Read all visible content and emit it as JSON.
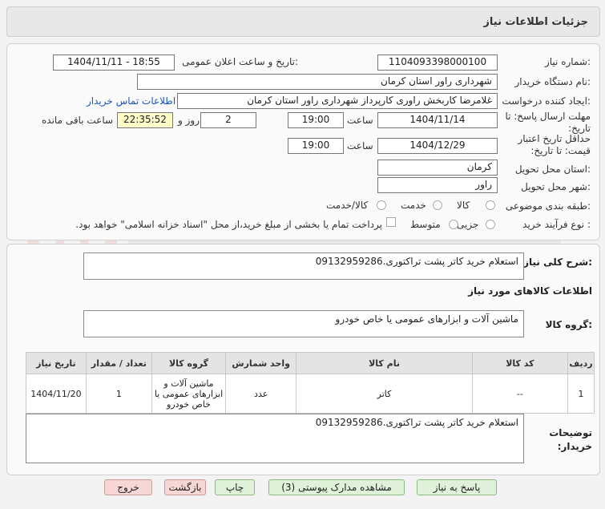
{
  "header": {
    "title": "جزئیات اطلاعات نیاز"
  },
  "form": {
    "need_number_label": "شماره نیاز:",
    "need_number": "1104093398000100",
    "announce_label": "تاریخ و ساعت اعلان عمومی:",
    "announce_value": "1404/11/11 - 18:55",
    "buyer_org_label": "نام دستگاه خریدار:",
    "buyer_org": "شهرداری راور استان کرمان",
    "creator_label": "ایجاد کننده درخواست:",
    "creator": "غلامرضا کاربخش راوری کارپرداز  شهرداری راور استان کرمان",
    "contact_link": "اطلاعات تماس خریدار",
    "reply_deadline_label": "مهلت ارسال پاسخ: تا تاریخ:",
    "reply_date": "1404/11/14",
    "time_label": "ساعت",
    "reply_time": "19:00",
    "days_value": "2",
    "days_label": "روز و",
    "countdown": "22:35:52",
    "remaining_label": "ساعت باقی مانده",
    "validity_label": "حداقل تاریخ اعتبار قیمت: تا تاریخ:",
    "validity_date": "1404/12/29",
    "validity_time_label": "ساعت",
    "validity_time": "19:00",
    "province_label": "استان محل تحویل:",
    "province": "کرمان",
    "city_label": "شهر محل تحویل:",
    "city": "راور",
    "category_label": "طبقه بندی موضوعی:",
    "category_options": [
      "کالا",
      "خدمت",
      "کالا/خدمت"
    ],
    "process_label": "نوع فرآیند خرید :",
    "process_options": [
      "جزیی",
      "متوسط"
    ],
    "payment_note": "پرداخت تمام یا بخشی از مبلغ خرید،از محل \"اسناد خزانه اسلامی\" خواهد بود."
  },
  "description": {
    "label": "شرح کلی نیاز:",
    "value": "استعلام خرید کاتر پشت تراکتوری.09132959286"
  },
  "goods": {
    "section_title": "اطلاعات کالاهای مورد نیاز",
    "group_label": "گروه کالا:",
    "group_value": "ماشین آلات و ابزارهای عمومی یا خاص خودرو"
  },
  "table": {
    "headers": [
      "ردیف",
      "کد کالا",
      "نام کالا",
      "واحد شمارش",
      "گروه کالا",
      "تعداد / مقدار",
      "تاریخ نیاز"
    ],
    "rows": [
      {
        "row": "1",
        "code": "--",
        "name": "کاتر",
        "unit": "عدد",
        "group": "ماشین آلات و ابزارهای عمومی یا خاص خودرو",
        "qty": "1",
        "date": "1404/11/20"
      }
    ]
  },
  "buyer_notes": {
    "label": "توضیحات خریدار:",
    "value": "استعلام خرید کاتر پشت تراکتوری.09132959286"
  },
  "buttons": {
    "reply": "پاسخ به نیاز",
    "attachments": "مشاهده مدارک پیوستی (3)",
    "print": "چاپ",
    "back": "بازگشت",
    "exit": "خروج"
  },
  "colors": {
    "accent_link": "#1a55b8",
    "countdown_bg": "#fdfbc8",
    "green_button": "#dff1d8",
    "red_button": "#f7d6d6"
  }
}
